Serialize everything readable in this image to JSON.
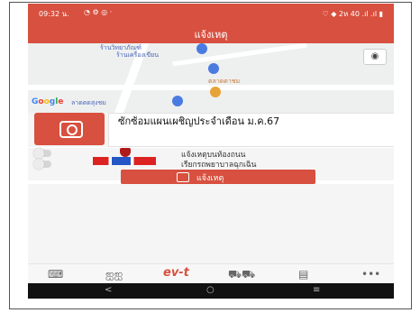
{
  "status": {
    "time": "09:32 น.",
    "icons": "◔ ⚙ ◎ ·",
    "right": "♡ ◆ 2ห 40 .ıl .ıl ▮"
  },
  "appbar": {
    "title": "แจ้งเหตุ"
  },
  "map": {
    "poi1": "ร้านวิทยาภัณฑ์",
    "poi1_sub": "ร้านเครื่องเขียน",
    "poi2": "ตลาดตาชม",
    "poi3": "ลาดตดสุงชม",
    "google": [
      "G",
      "o",
      "o",
      "g",
      "l",
      "e"
    ],
    "locate_icon": "target-icon"
  },
  "notice": {
    "text": "ซักซ้อมแผนเผชิญประจำเดือน ม.ค.67"
  },
  "options": [
    {
      "label": "แจ้งเหตุบนท้องถนน"
    },
    {
      "label": "เรียกรถพยาบาลฉุกเฉิน"
    }
  ],
  "report_button": {
    "label": "แจ้งเหตุ"
  },
  "bottom_nav": [
    {
      "label": "⌨",
      "icon": "chat-icon"
    },
    {
      "label": "ஐஐ",
      "icon": "people-icon"
    },
    {
      "label": "ev-t",
      "icon": "logo-icon"
    },
    {
      "label": "⛟⛟",
      "icon": "car-icon"
    },
    {
      "label": "▤",
      "icon": "card-icon"
    },
    {
      "label": "•••",
      "icon": "more-icon"
    }
  ],
  "sysnav": {
    "back": "<",
    "home": "○",
    "menu": "≡"
  },
  "colors": {
    "primary": "#d8503f"
  }
}
